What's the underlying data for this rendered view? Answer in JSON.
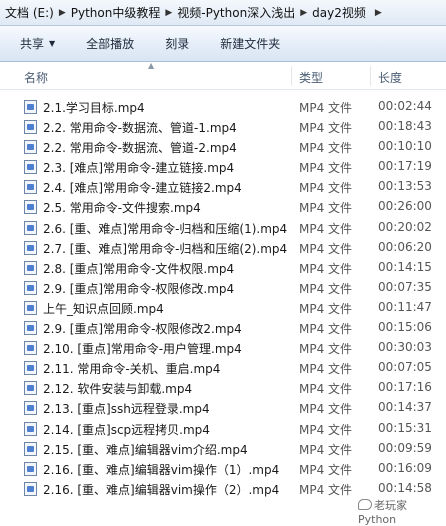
{
  "breadcrumb": [
    "文档 (E:)",
    "Python中级教程",
    "视频-Python深入浅出",
    "day2视频"
  ],
  "toolbar": {
    "share": "共享",
    "play_all": "全部播放",
    "burn": "刻录",
    "new_folder": "新建文件夹"
  },
  "columns": {
    "name": "名称",
    "type": "类型",
    "length": "长度"
  },
  "files": [
    {
      "name": "2.1.学习目标.mp4",
      "type": "MP4 文件",
      "length": "00:02:44"
    },
    {
      "name": "2.2. 常用命令-数据流、管道-1.mp4",
      "type": "MP4 文件",
      "length": "00:18:43"
    },
    {
      "name": "2.2. 常用命令-数据流、管道-2.mp4",
      "type": "MP4 文件",
      "length": "00:10:10"
    },
    {
      "name": "2.3. [难点]常用命令-建立链接.mp4",
      "type": "MP4 文件",
      "length": "00:17:19"
    },
    {
      "name": "2.4. [难点]常用命令-建立链接2.mp4",
      "type": "MP4 文件",
      "length": "00:13:53"
    },
    {
      "name": "2.5. 常用命令-文件搜索.mp4",
      "type": "MP4 文件",
      "length": "00:26:00"
    },
    {
      "name": "2.6. [重、难点]常用命令-归档和压缩(1).mp4",
      "type": "MP4 文件",
      "length": "00:20:02"
    },
    {
      "name": "2.7. [重、难点]常用命令-归档和压缩(2).mp4",
      "type": "MP4 文件",
      "length": "00:06:20"
    },
    {
      "name": "2.8. [重点]常用命令-文件权限.mp4",
      "type": "MP4 文件",
      "length": "00:14:15"
    },
    {
      "name": "2.9. [重点]常用命令-权限修改.mp4",
      "type": "MP4 文件",
      "length": "00:07:35"
    },
    {
      "name": "上午_知识点回顾.mp4",
      "type": "MP4 文件",
      "length": "00:11:47"
    },
    {
      "name": "2.9. [重点]常用命令-权限修改2.mp4",
      "type": "MP4 文件",
      "length": "00:15:06"
    },
    {
      "name": "2.10. [重点]常用命令-用户管理.mp4",
      "type": "MP4 文件",
      "length": "00:30:03"
    },
    {
      "name": "2.11. 常用命令-关机、重启.mp4",
      "type": "MP4 文件",
      "length": "00:07:05"
    },
    {
      "name": "2.12. 软件安装与卸载.mp4",
      "type": "MP4 文件",
      "length": "00:17:16"
    },
    {
      "name": "2.13. [重点]ssh远程登录.mp4",
      "type": "MP4 文件",
      "length": "00:14:37"
    },
    {
      "name": "2.14. [重点]scp远程拷贝.mp4",
      "type": "MP4 文件",
      "length": "00:15:31"
    },
    {
      "name": "2.15. [重、难点]编辑器vim介绍.mp4",
      "type": "MP4 文件",
      "length": "00:09:59"
    },
    {
      "name": "2.16. [重、难点]编辑器vim操作（1）.mp4",
      "type": "MP4 文件",
      "length": "00:16:09"
    },
    {
      "name": "2.16. [重、难点]编辑器vim操作（2）.mp4",
      "type": "MP4 文件",
      "length": "00:14:58"
    }
  ],
  "watermark": "老玩家Python"
}
